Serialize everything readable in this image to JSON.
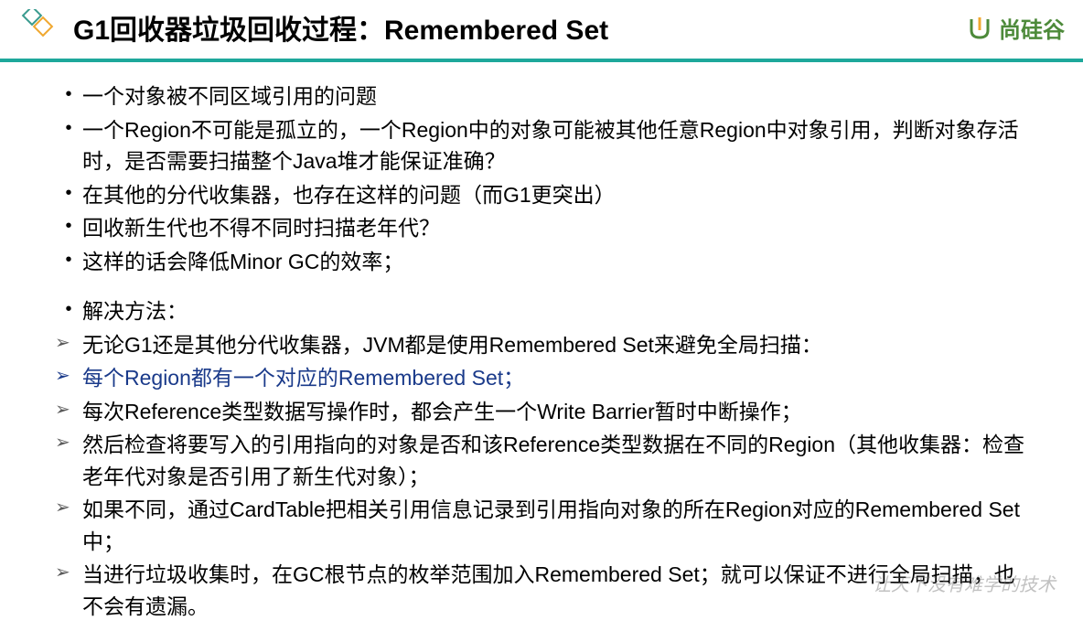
{
  "header": {
    "title": "G1回收器垃圾回收过程：Remembered Set",
    "brand": "尚硅谷"
  },
  "bullets": {
    "dot_items": [
      "一个对象被不同区域引用的问题",
      "一个Region不可能是孤立的，一个Region中的对象可能被其他任意Region中对象引用，判断对象存活时，是否需要扫描整个Java堆才能保证准确？",
      "在其他的分代收集器，也存在这样的问题（而G1更突出）",
      "回收新生代也不得不同时扫描老年代？",
      "这样的话会降低Minor GC的效率；"
    ],
    "solution_label": "解决方法：",
    "arrow_items": [
      {
        "text": "无论G1还是其他分代收集器，JVM都是使用Remembered Set来避免全局扫描：",
        "highlight": false
      },
      {
        "text": "每个Region都有一个对应的Remembered Set；",
        "highlight": true
      },
      {
        "text": "每次Reference类型数据写操作时，都会产生一个Write Barrier暂时中断操作；",
        "highlight": false
      },
      {
        "text": "然后检查将要写入的引用指向的对象是否和该Reference类型数据在不同的Region（其他收集器：检查老年代对象是否引用了新生代对象）；",
        "highlight": false
      },
      {
        "text": "如果不同，通过CardTable把相关引用信息记录到引用指向对象的所在Region对应的Remembered Set中；",
        "highlight": false
      },
      {
        "text": "当进行垃圾收集时，在GC根节点的枚举范围加入Remembered Set；就可以保证不进行全局扫描，也不会有遗漏。",
        "highlight": false
      }
    ]
  },
  "watermark": "让天下没有难学的技术"
}
